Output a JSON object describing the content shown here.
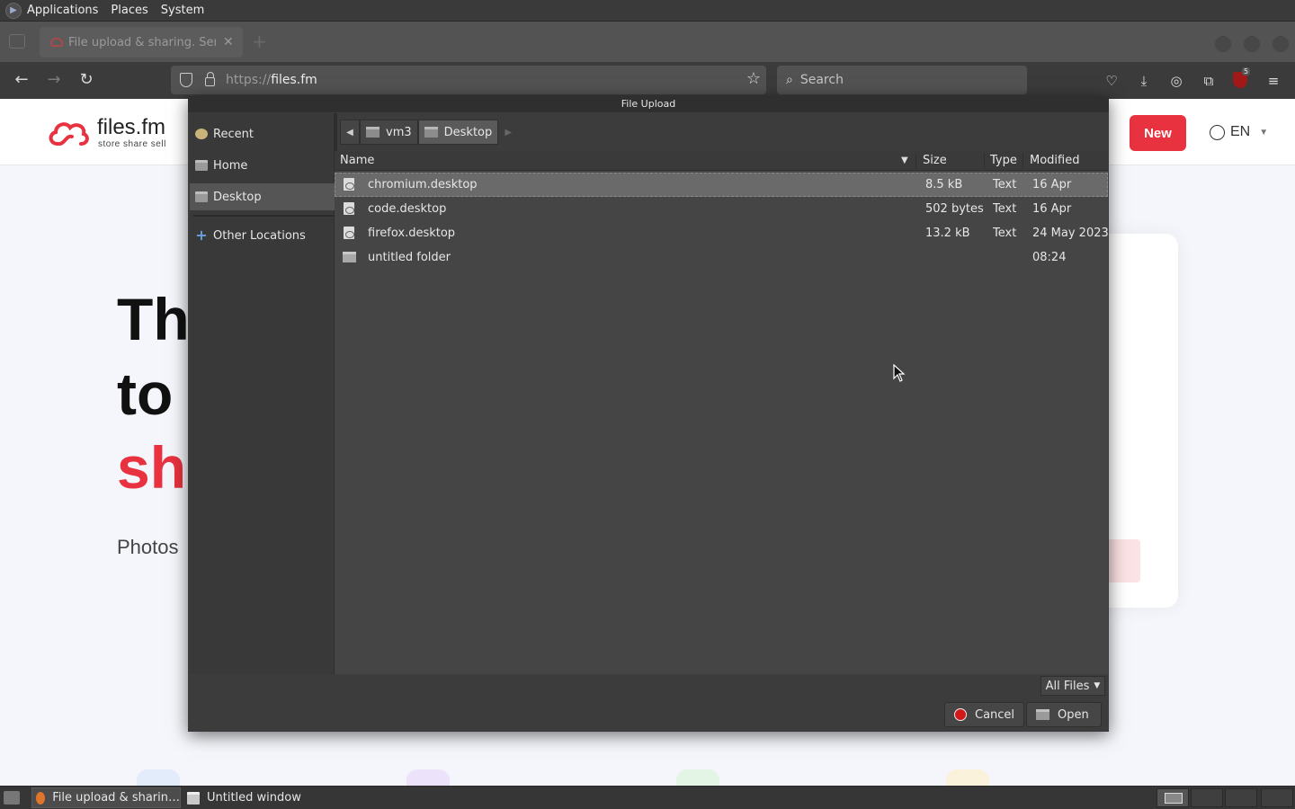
{
  "system_panel": {
    "menus": [
      "Applications",
      "Places",
      "System"
    ]
  },
  "browser": {
    "tab_title": "File upload & sharing. Send",
    "url_scheme": "https://",
    "url_host": "files.fm",
    "search_placeholder": "Search",
    "ublock_count": "5"
  },
  "website": {
    "logo_text": "files.fm",
    "logo_tagline": "store  share  sell",
    "new_button": "New",
    "language": "EN",
    "hero_line1": "Th",
    "hero_line2": "to",
    "hero_line3": "sh",
    "hero_sub": "Photos"
  },
  "dialog": {
    "title": "File Upload",
    "places": [
      {
        "label": "Recent",
        "icon": "recent-icon"
      },
      {
        "label": "Home",
        "icon": "folder-home-icon"
      },
      {
        "label": "Desktop",
        "icon": "folder-desktop-icon",
        "active": true
      },
      {
        "label": "Other Locations",
        "icon": "plus-icon"
      }
    ],
    "path": [
      "vm3",
      "Desktop"
    ],
    "columns": {
      "name": "Name",
      "size": "Size",
      "type": "Type",
      "modified": "Modified"
    },
    "files": [
      {
        "name": "chromium.desktop",
        "size": "8.5 kB",
        "type": "Text",
        "modified": "16 Apr",
        "kind": "file",
        "selected": true
      },
      {
        "name": "code.desktop",
        "size": "502 bytes",
        "type": "Text",
        "modified": "16 Apr",
        "kind": "file"
      },
      {
        "name": "firefox.desktop",
        "size": "13.2 kB",
        "type": "Text",
        "modified": "24 May 2023",
        "kind": "file"
      },
      {
        "name": "untitled folder",
        "size": "",
        "type": "",
        "modified": "08:24",
        "kind": "folder"
      }
    ],
    "filter": "All Files",
    "cancel_label": "Cancel",
    "open_label": "Open"
  },
  "taskbar": {
    "tasks": [
      {
        "label": "File upload & sharin…",
        "active": true
      },
      {
        "label": "Untitled window",
        "active": false
      }
    ]
  }
}
